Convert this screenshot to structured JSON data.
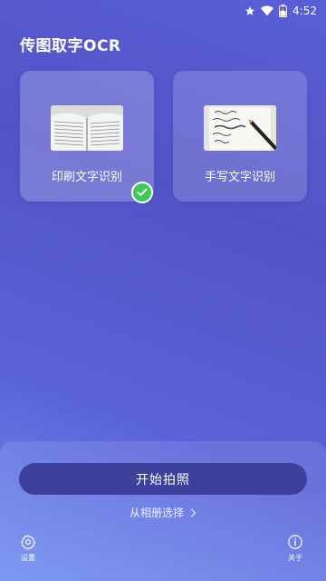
{
  "status_bar": {
    "time": "4:52",
    "icons": [
      "star-icon",
      "wifi-icon",
      "battery-charging-icon"
    ]
  },
  "app": {
    "title": "传图取字OCR"
  },
  "modes": [
    {
      "label": "印刷文字识别",
      "selected": true,
      "thumbnail": "open-book-photo"
    },
    {
      "label": "手写文字识别",
      "selected": false,
      "thumbnail": "handwritten-note-photo"
    }
  ],
  "actions": {
    "take_photo_label": "开始拍照",
    "album_label": "从相册选择"
  },
  "nav": {
    "settings_label": "设置",
    "about_label": "关于"
  },
  "colors": {
    "accent_check": "#3fc85a",
    "primary_button": "#3f3f9c"
  }
}
